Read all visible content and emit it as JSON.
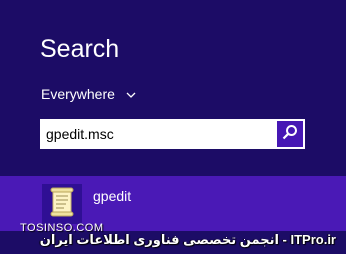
{
  "search": {
    "title": "Search",
    "scope_label": "Everywhere",
    "query": "gpedit.msc"
  },
  "result": {
    "label": "gpedit",
    "icon": "scroll-document-icon"
  },
  "watermark": {
    "primary": "ITPro.ir - انجمن تخصصی فناوری اطلاعات ایران",
    "secondary": "TOSINSO.COM"
  },
  "colors": {
    "background": "#1c0c66",
    "result_highlight": "#4a19b6",
    "search_button": "#4617b4"
  }
}
